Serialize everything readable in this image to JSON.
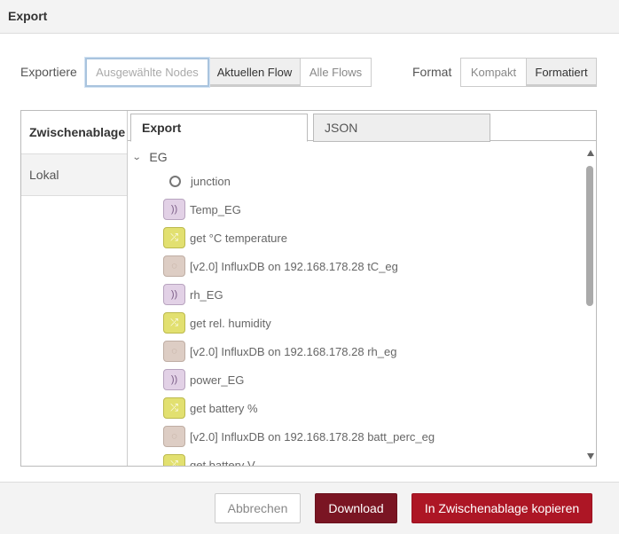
{
  "dialog": {
    "title": "Export"
  },
  "export_scope": {
    "label": "Exportiere",
    "options": [
      "Ausgewählte Nodes",
      "Aktuellen Flow",
      "Alle Flows"
    ],
    "selected": "Aktuellen Flow",
    "focused": "Ausgewählte Nodes"
  },
  "format": {
    "label": "Format",
    "options": [
      "Kompakt",
      "Formatiert"
    ],
    "selected": "Formatiert"
  },
  "side_tabs": [
    "Zwischenablage",
    "Lokal"
  ],
  "content_tabs": [
    "Export",
    "JSON"
  ],
  "tree": {
    "root": "EG",
    "nodes": [
      {
        "type": "junction",
        "label": "junction"
      },
      {
        "type": "pink",
        "icon": "wireless-icon",
        "label": "Temp_EG"
      },
      {
        "type": "yellow",
        "icon": "shuffle-icon",
        "label": "get °C temperature"
      },
      {
        "type": "tan",
        "icon": "database-icon",
        "label": "[v2.0] InfluxDB on 192.168.178.28 tC_eg"
      },
      {
        "type": "pink",
        "icon": "wireless-icon",
        "label": "rh_EG"
      },
      {
        "type": "yellow",
        "icon": "shuffle-icon",
        "label": "get rel. humidity"
      },
      {
        "type": "tan",
        "icon": "database-icon",
        "label": "[v2.0] InfluxDB on 192.168.178.28 rh_eg"
      },
      {
        "type": "pink",
        "icon": "wireless-icon",
        "label": "power_EG"
      },
      {
        "type": "yellow",
        "icon": "shuffle-icon",
        "label": "get battery %"
      },
      {
        "type": "tan",
        "icon": "database-icon",
        "label": "[v2.0] InfluxDB on 192.168.178.28 batt_perc_eg"
      },
      {
        "type": "yellow",
        "icon": "shuffle-icon",
        "label": "get battery V"
      }
    ]
  },
  "footer": {
    "cancel": "Abbrechen",
    "download": "Download",
    "copy": "In Zwischenablage kopieren"
  },
  "colors": {
    "download_bg": "#7a1523",
    "copy_bg": "#ad1625",
    "node_pink": "#e2d1e6",
    "node_yellow": "#e2e070",
    "node_tan": "#ddcdc4"
  }
}
